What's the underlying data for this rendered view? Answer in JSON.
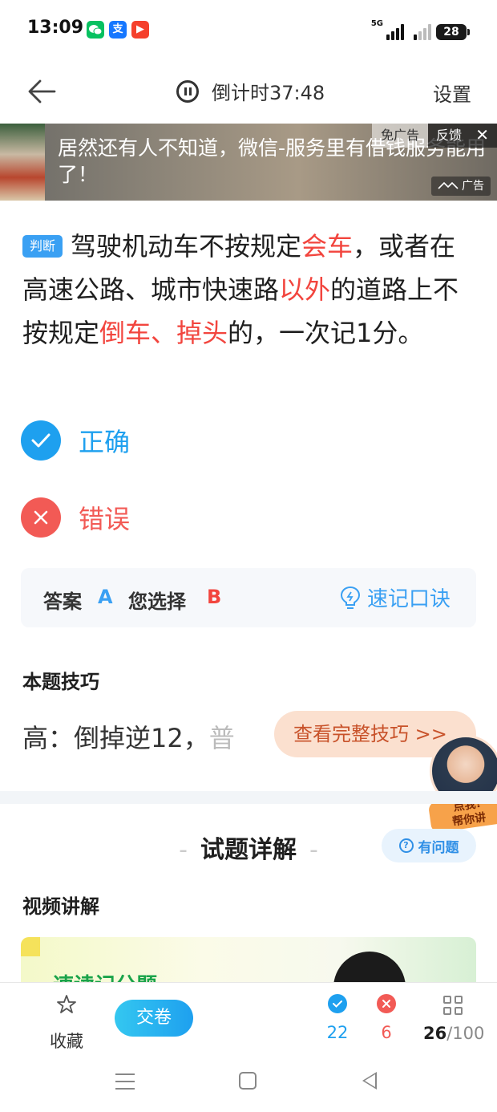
{
  "status_bar": {
    "time": "13:09",
    "network": "5G",
    "battery": "28",
    "apps": [
      {
        "name": "wechat-icon",
        "glyph": "",
        "color": "#07c160"
      },
      {
        "name": "alipay-icon",
        "glyph": "支",
        "color": "#1677ff"
      },
      {
        "name": "video-app-icon",
        "glyph": "▶",
        "color": "#f5402c"
      }
    ]
  },
  "nav": {
    "countdown_label": "倒计时37:48",
    "settings_label": "设置"
  },
  "ad": {
    "text": "居然还有人不知道，微信-服务里有借钱服务能用了！",
    "free_label": "免广告",
    "feedback_label": "反馈",
    "close_glyph": "✕",
    "tag_label": "广告"
  },
  "question": {
    "type_label": "判断",
    "segments": [
      {
        "text": "驾驶机动车不按规定",
        "highlight": false
      },
      {
        "text": "会车",
        "highlight": true
      },
      {
        "text": "，或者在高速公路、城市快速路",
        "highlight": false
      },
      {
        "text": "以外",
        "highlight": true
      },
      {
        "text": "的道路上不按规定",
        "highlight": false
      },
      {
        "text": "倒车、掉头",
        "highlight": true
      },
      {
        "text": "的，一次记1分。",
        "highlight": false
      }
    ]
  },
  "options": [
    {
      "label": "正确",
      "state": "correct",
      "color": "#1ea0ef"
    },
    {
      "label": "错误",
      "state": "wrong",
      "color": "#f25a55"
    }
  ],
  "answer": {
    "answer_label": "答案",
    "answer_value": "A",
    "chosen_label": "您选择",
    "chosen_value": "B",
    "mnemonic_label": "速记口诀"
  },
  "tips": {
    "title": "本题技巧",
    "text": "高：倒掉逆12，",
    "text_fade": "普",
    "button_label": "查看完整技巧 >>",
    "avatar_badge": "点我!\n帮你讲"
  },
  "explanation": {
    "title": "试题详解",
    "ask_label": "有问题",
    "video_title": "视频讲解",
    "video_text": "速读记分题"
  },
  "toolbar": {
    "favorite_label": "收藏",
    "submit_label": "交卷",
    "correct_count": "22",
    "wrong_count": "6",
    "current": "26",
    "total": "/100"
  }
}
